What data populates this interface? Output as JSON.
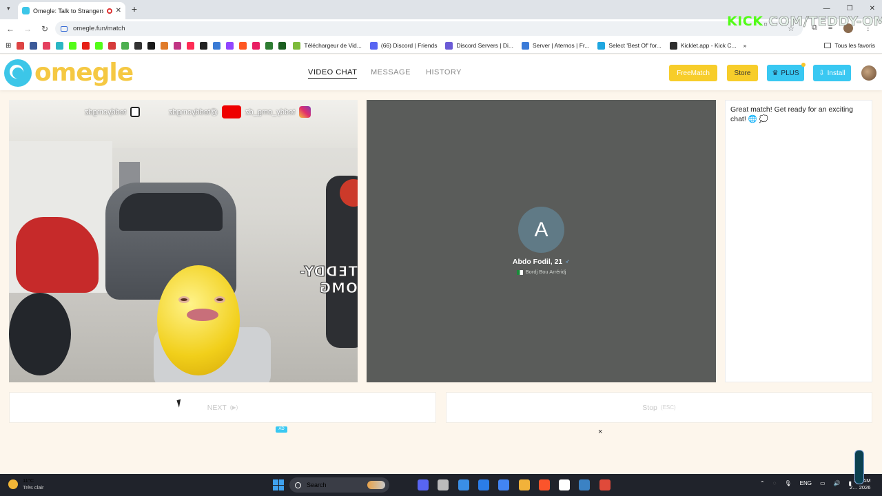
{
  "browser": {
    "tab_title": "Omegle: Talk to Strangers",
    "tab_close": "✕",
    "new_tab": "+",
    "url": "omegle.fun/match",
    "back": "←",
    "forward": "→",
    "reload": "↻",
    "star": "☆",
    "window_controls": [
      "—",
      "❐",
      "✕"
    ],
    "stream_overlay_prefix": "KICK",
    "stream_overlay_suffix": ".COM/TEDDY-OMG",
    "bookmarks": [
      {
        "label": "Téléchargeur de Vid...",
        "color": "#7dbb3a"
      },
      {
        "label": "(66) Discord | Friends",
        "color": "#5865f2"
      },
      {
        "label": "Discord Servers | Di...",
        "color": "#6b5bd6"
      },
      {
        "label": "Server | Aternos | Fr...",
        "color": "#3b7bd8"
      },
      {
        "label": "Select 'Best Of' for...",
        "color": "#1ea6e0"
      },
      {
        "label": "Kicklet.app - Kick C...",
        "color": "#2e2e2e"
      }
    ],
    "bookmark_icon_colors": [
      "#d44",
      "#3b5998",
      "#e4405f",
      "#2bb6c4",
      "#53fc18",
      "#e62117",
      "#53fc18",
      "#d63b3b",
      "#4caf50",
      "#333",
      "#1a1a1a",
      "#e07b2a",
      "#c13584",
      "#fe2c55",
      "#222",
      "#3a7bd5",
      "#9146ff",
      "#ff5722",
      "#e91e63",
      "#2e7d32",
      "#1b5e20"
    ],
    "all_favorites": "Tous les favoris"
  },
  "header": {
    "logo_text": "omegle",
    "nav": [
      "VIDEO CHAT",
      "MESSAGE",
      "HISTORY"
    ],
    "freematch": "FreeMatch",
    "store": "Store",
    "plus": "PLUS",
    "plus_icon": "♛",
    "install": "Install",
    "install_icon": "⇩"
  },
  "local_video": {
    "social_handles": [
      "teddy_omg_dz",
      "@teddyomgdz",
      "teddyomgdz"
    ],
    "watermark": "TEDDY-OMG"
  },
  "remote": {
    "avatar_letter": "A",
    "name": "Abdo Fodil, 21",
    "gender_icon": "♂",
    "location": "Bordj Bou Arréridj"
  },
  "chat": {
    "message": "Great match! Get ready for an exciting chat! 🌐 💭"
  },
  "controls": {
    "next_label": "NEXT",
    "next_hint": "(▶)",
    "stop_label": "Stop",
    "stop_hint": "(ESC)",
    "ad_badge": "AD",
    "ad_close": "×"
  },
  "taskbar": {
    "temperature": "11°C",
    "weather": "Très clair",
    "search": "Search",
    "language": "ENG",
    "time": "1… AM",
    "date": "2… 2026",
    "app_colors": [
      "#5865f2",
      "#bbbbbb",
      "#3a8ee6",
      "#2b7de9",
      "#4285f4",
      "#f2b23a",
      "#fb542b",
      "#ffffff",
      "#3b82c4",
      "#e04a3a"
    ]
  },
  "colors": {
    "accent_yellow": "#f7cd2a",
    "accent_blue": "#39c8f2",
    "logo_blue": "#3cc6e8",
    "remote_bg": "#5a5c5a"
  }
}
